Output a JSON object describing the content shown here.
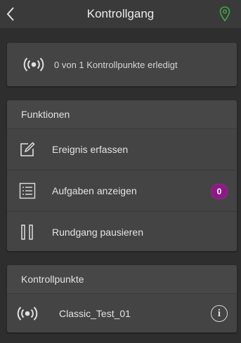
{
  "header": {
    "title": "Kontrollgang",
    "back_icon": "chevron-left-icon",
    "map_icon": "map-pin-icon",
    "map_icon_color": "#3fa84a"
  },
  "status": {
    "icon": "broadcast-icon",
    "text": "0 von 1 Kontrollpunkte erledigt"
  },
  "functions": {
    "heading": "Funktionen",
    "items": [
      {
        "label": "Ereignis erfassen",
        "icon": "edit-icon"
      },
      {
        "label": "Aufgaben anzeigen",
        "icon": "task-list-icon",
        "badge": "0"
      },
      {
        "label": "Rundgang pausieren",
        "icon": "pause-icon"
      }
    ]
  },
  "checkpoints": {
    "heading": "Kontrollpunkte",
    "items": [
      {
        "label": "Classic_Test_01",
        "icon": "broadcast-icon",
        "action_icon": "info-icon",
        "info_symbol": "i"
      }
    ]
  },
  "colors": {
    "background": "#2e2e2e",
    "card": "#444444",
    "badge": "#8a1a84"
  }
}
